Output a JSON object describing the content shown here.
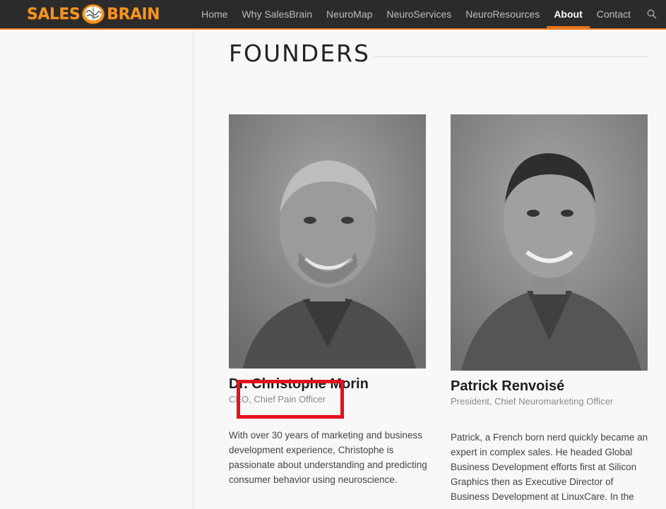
{
  "header": {
    "logo_text_left": "SALES",
    "logo_text_right": "BRAIN",
    "nav": [
      {
        "label": "Home"
      },
      {
        "label": "Why SalesBrain"
      },
      {
        "label": "NeuroMap"
      },
      {
        "label": "NeuroServices"
      },
      {
        "label": "NeuroResources"
      },
      {
        "label": "About"
      },
      {
        "label": "Contact"
      }
    ],
    "active_nav": "About",
    "search_icon": "search-icon"
  },
  "main": {
    "section_title": "FOUNDERS",
    "founders": [
      {
        "name": "Dr. Christophe Morin",
        "role": "CEO, Chief Pain Officer",
        "bio": "With over 30 years of marketing and business development experience, Christophe is passionate about understanding and predicting consumer behavior using neuroscience."
      },
      {
        "name": "Patrick Renvoisé",
        "role": "President, Chief Neuromarketing Officer",
        "bio": "Patrick, a French born nerd quickly became an expert in complex sales.  He headed Global Business Development efforts first at Silicon Graphics then as Executive Director of Business Development at LinuxCare. In the"
      }
    ]
  },
  "colors": {
    "accent": "#e8761c",
    "header_bg": "#2b2b2b",
    "highlight": "#e3101e"
  }
}
